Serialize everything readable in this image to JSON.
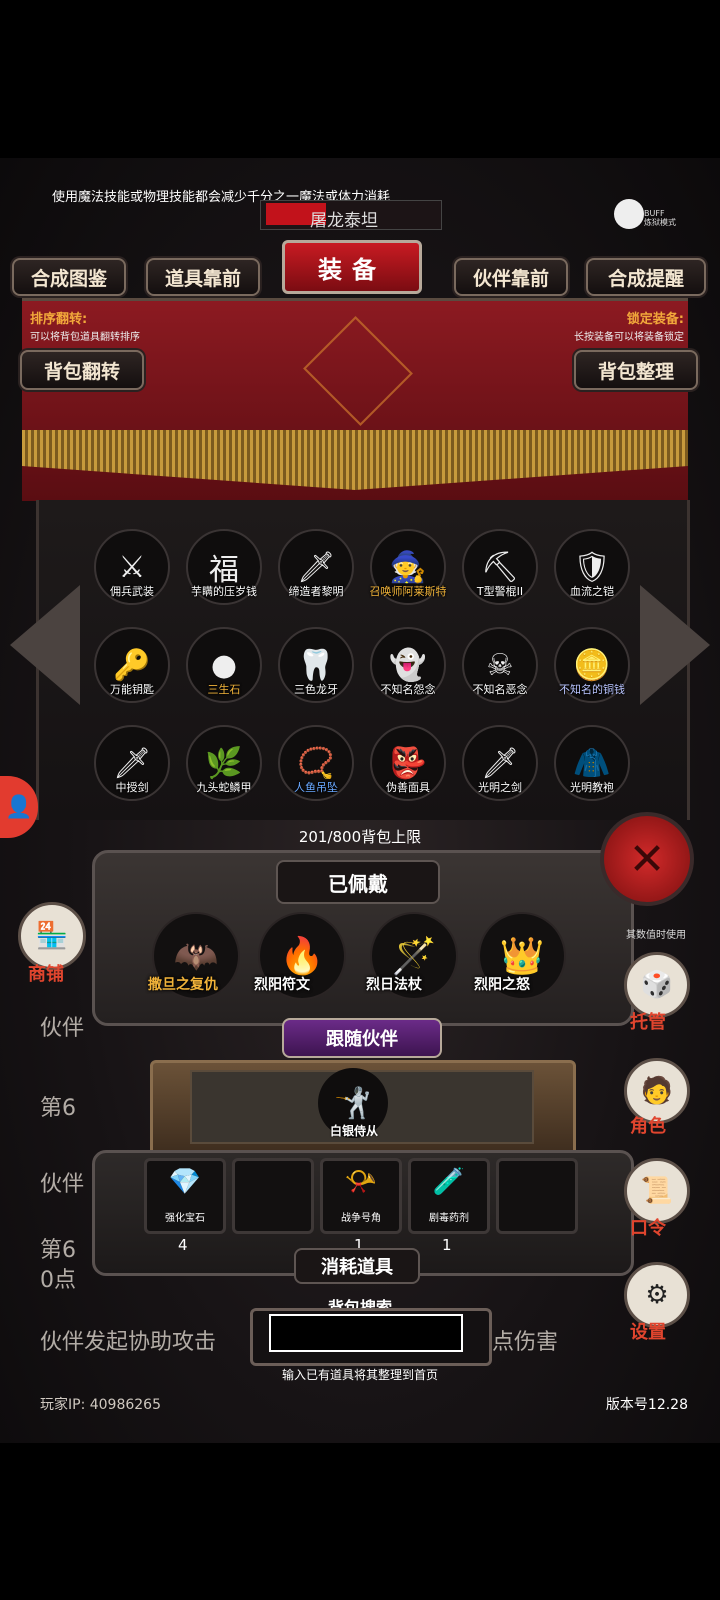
{
  "tip": "使用魔法技能或物理技能都会减少千分之一魔法或体力消耗",
  "title_bar": "屠龙泰坦",
  "buff_badge": {
    "line1": "BUFF",
    "line2": "炼狱模式"
  },
  "tabs": {
    "left1": "合成图鉴",
    "left2": "道具靠前",
    "center": "装备",
    "right1": "伙伴靠前",
    "right2": "合成提醒"
  },
  "sort": {
    "label": "排序翻转:",
    "desc": "可以将背包道具翻转排序"
  },
  "lock": {
    "label": "锁定装备:",
    "desc": "长按装备可以将装备锁定"
  },
  "buttons": {
    "flip": "背包翻转",
    "organize": "背包整理"
  },
  "items": [
    {
      "name": "佣兵武装",
      "icon": "⚔",
      "color": "#ffffff"
    },
    {
      "name": "芋瞒的压岁钱",
      "icon": "福",
      "color": "#ffffff"
    },
    {
      "name": "缔造者黎明",
      "icon": "🗡",
      "color": "#ffffff"
    },
    {
      "name": "召唤师阿莱斯特",
      "icon": "🧙",
      "color": "#f2b43a"
    },
    {
      "name": "T型警棍II",
      "icon": "⛏",
      "color": "#ffffff"
    },
    {
      "name": "血流之铠",
      "icon": "🛡",
      "color": "#ffffff"
    },
    {
      "name": "万能钥匙",
      "icon": "🔑",
      "color": "#ffffff"
    },
    {
      "name": "三生石",
      "icon": "●",
      "color": "#f2b43a"
    },
    {
      "name": "三色龙牙",
      "icon": "🦷",
      "color": "#ffffff"
    },
    {
      "name": "不知名怨念",
      "icon": "👻",
      "color": "#ffffff"
    },
    {
      "name": "不知名恶念",
      "icon": "☠",
      "color": "#ffffff"
    },
    {
      "name": "不知名的铜钱",
      "icon": "🪙",
      "color": "#b9c4ff"
    },
    {
      "name": "中授剑",
      "icon": "🗡",
      "color": "#ffffff"
    },
    {
      "name": "九头蛇鳞甲",
      "icon": "🌿",
      "color": "#ffffff"
    },
    {
      "name": "人鱼吊坠",
      "icon": "📿",
      "color": "#6aa8ff"
    },
    {
      "name": "伪善面具",
      "icon": "👺",
      "color": "#ffffff"
    },
    {
      "name": "光明之剑",
      "icon": "🗡",
      "color": "#ffffff"
    },
    {
      "name": "光明教袍",
      "icon": "🧥",
      "color": "#ffffff"
    }
  ],
  "capacity": "201/800背包上限",
  "equipped": {
    "title": "已佩戴",
    "items": [
      {
        "name": "撒旦之复仇",
        "icon": "🦇",
        "color": "#f2b43a"
      },
      {
        "name": "烈阳符文",
        "icon": "🔥",
        "color": "#ffffff"
      },
      {
        "name": "烈日法杖",
        "icon": "🪄",
        "color": "#ffffff"
      },
      {
        "name": "烈阳之怒",
        "icon": "👑",
        "color": "#ffffff"
      }
    ]
  },
  "companion": {
    "tab": "跟随伙伴",
    "name": "白银侍从",
    "icon": "🤺"
  },
  "consumables": {
    "title": "消耗道具",
    "slots": [
      {
        "name": "强化宝石",
        "icon": "💎",
        "count": "4"
      },
      {
        "name": "",
        "icon": "",
        "count": ""
      },
      {
        "name": "战争号角",
        "icon": "📯",
        "count": "1"
      },
      {
        "name": "剧毒药剂",
        "icon": "🧪",
        "count": "1"
      },
      {
        "name": "",
        "icon": "",
        "count": ""
      }
    ]
  },
  "search": {
    "label": "背包搜索",
    "value": "",
    "hint": "输入已有道具将其整理到首页"
  },
  "side": {
    "shop": "商铺",
    "manage": "托管",
    "role": "角色",
    "password": "口令",
    "settings": "设置",
    "ratio_text": "其数值时使用"
  },
  "background_text": {
    "line1": "伙伴",
    "line2": "第6",
    "line3": "伙伴",
    "line4": "第6",
    "line5": "0点",
    "line6": "伙伴发起协助攻击",
    "line6_end": "点伤害"
  },
  "footer": {
    "ip": "玩家IP:  40986265",
    "version": "版本号12.28"
  }
}
